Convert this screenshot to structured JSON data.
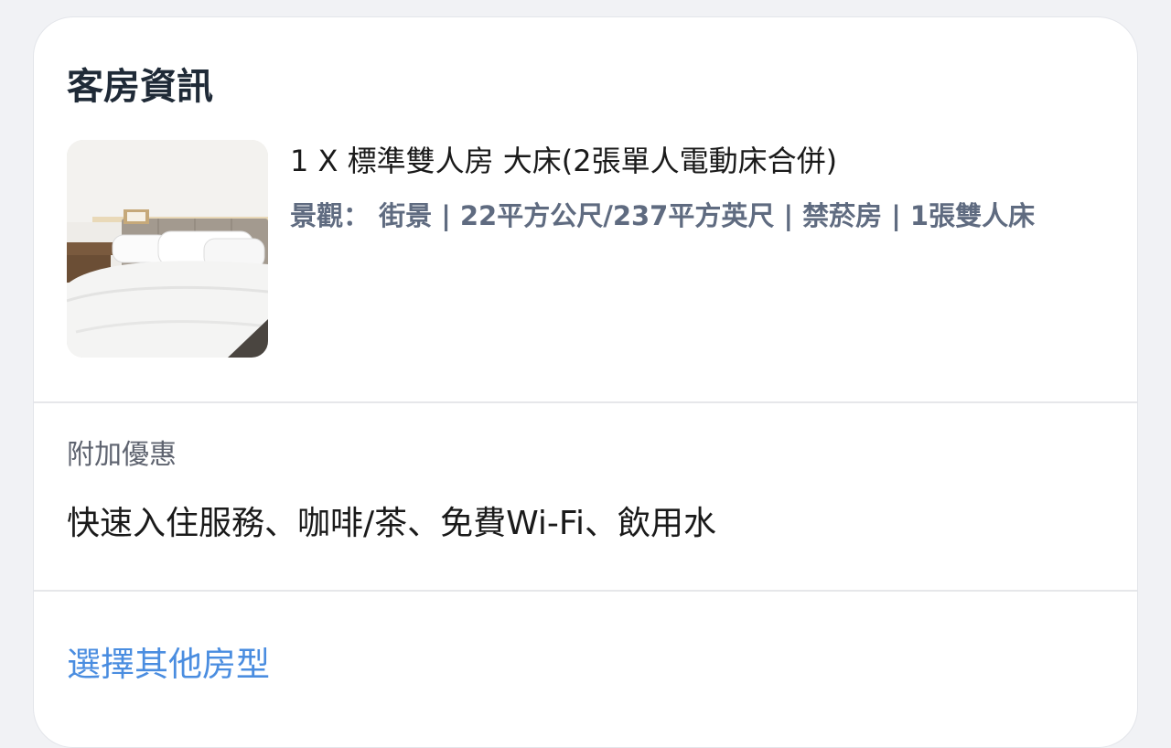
{
  "room_section": {
    "title": "客房資訊",
    "room_name": "1 X 標準雙人房 大床(2張單人電動床合併)",
    "room_details": "景觀： 街景 | 22平方公尺/237平方英尺 | 禁菸房 | 1張雙人床",
    "photo_icon": "hotel-bedroom-photo"
  },
  "extras_section": {
    "label": "附加優惠",
    "value": "快速入住服務、咖啡/茶、免費Wi-Fi、飲用水"
  },
  "footer": {
    "other_rooms_link": "選擇其他房型"
  },
  "colors": {
    "title": "#1f2a37",
    "details": "#5f6b80",
    "link": "#4a8de0",
    "divider": "#e6e7ea"
  }
}
